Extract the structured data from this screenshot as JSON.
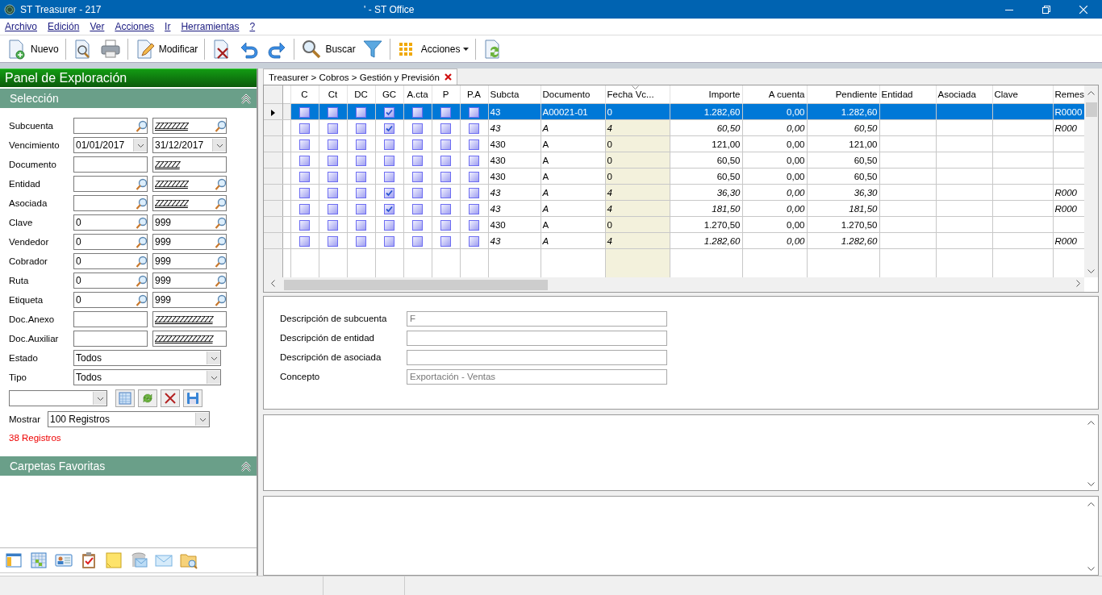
{
  "window": {
    "title": "ST Treasurer - 217",
    "subtitle": "' - ST Office"
  },
  "menu": [
    {
      "label": "Archivo"
    },
    {
      "label": "Edición"
    },
    {
      "label": "Ver"
    },
    {
      "label": "Acciones"
    },
    {
      "label": "Ir"
    },
    {
      "label": "Herramientas"
    },
    {
      "label": "?"
    }
  ],
  "toolbar": [
    {
      "kind": "button",
      "label": "Nuevo"
    },
    {
      "kind": "separator"
    },
    {
      "kind": "button"
    },
    {
      "kind": "button"
    },
    {
      "kind": "separator"
    },
    {
      "kind": "button",
      "label": "Modificar"
    },
    {
      "kind": "separator"
    },
    {
      "kind": "button"
    },
    {
      "kind": "button"
    },
    {
      "kind": "button"
    },
    {
      "kind": "separator"
    },
    {
      "kind": "button",
      "label": "Buscar"
    },
    {
      "kind": "button"
    },
    {
      "kind": "separator"
    },
    {
      "kind": "button",
      "label": "Acciones",
      "dropdown": true
    },
    {
      "kind": "separator"
    },
    {
      "kind": "button"
    }
  ],
  "explorer": {
    "title": "Panel de Exploración",
    "selection_title": "Selección",
    "filters": [
      {
        "label": "Subcuenta",
        "kind": "search",
        "to": {
          "value": "ZZZZZZZZ",
          "mask": true
        }
      },
      {
        "label": "Vencimiento",
        "kind": "date",
        "from": {
          "value": "01/01/2017"
        },
        "to": {
          "value": "31/12/2017"
        }
      },
      {
        "label": "Documento",
        "kind": "text",
        "to": {
          "value": "ZZZZZZ",
          "mask": true
        }
      },
      {
        "label": "Entidad",
        "kind": "search",
        "to": {
          "value": "ZZZZZZZZ",
          "mask": true
        }
      },
      {
        "label": "Asociada",
        "kind": "search",
        "to": {
          "value": "ZZZZZZZZ",
          "mask": true
        }
      },
      {
        "label": "Clave",
        "kind": "search",
        "from": {
          "value": "0"
        },
        "to": {
          "value": "999"
        }
      },
      {
        "label": "Vendedor",
        "kind": "search",
        "from": {
          "value": "0"
        },
        "to": {
          "value": "999"
        }
      },
      {
        "label": "Cobrador",
        "kind": "search",
        "from": {
          "value": "0"
        },
        "to": {
          "value": "999"
        }
      },
      {
        "label": "Ruta",
        "kind": "search",
        "from": {
          "value": "0"
        },
        "to": {
          "value": "999"
        }
      },
      {
        "label": "Etiqueta",
        "kind": "search",
        "from": {
          "value": "0"
        },
        "to": {
          "value": "999"
        }
      },
      {
        "label": "Doc.Anexo",
        "kind": "text",
        "to": {
          "value": "ZZZZZZZZZZZZZZ",
          "mask": true
        }
      },
      {
        "label": "Doc.Auxiliar",
        "kind": "text",
        "to": {
          "value": "ZZZZZZZZZZZZZZ",
          "mask": true
        }
      },
      {
        "label": "Estado",
        "kind": "select",
        "value": "Todos"
      },
      {
        "label": "Tipo",
        "kind": "select",
        "value": "Todos"
      }
    ],
    "show_label": "Mostrar",
    "show_value": "100  Registros",
    "count": "38 Registros",
    "favorites_title": "Carpetas Favoritas"
  },
  "tab": {
    "label": "Treasurer > Cobros > Gestión y Previsión",
    "selected": true
  },
  "table": {
    "check_columns": [
      {
        "label": "C"
      },
      {
        "label": "Ct"
      },
      {
        "label": "DC"
      },
      {
        "label": "GC"
      },
      {
        "label": "A.cta"
      },
      {
        "label": "P"
      },
      {
        "label": "P.A"
      }
    ],
    "columns": [
      {
        "label": "Subcta",
        "kind": "text"
      },
      {
        "label": "Documento",
        "kind": "text"
      },
      {
        "label": "Fecha Vc...",
        "kind": "text",
        "sorted": true
      },
      {
        "label": "Importe",
        "kind": "number"
      },
      {
        "label": "A cuenta",
        "kind": "number"
      },
      {
        "label": "Pendiente",
        "kind": "number"
      },
      {
        "label": "Entidad",
        "kind": "text"
      },
      {
        "label": "Asociada",
        "kind": "text"
      },
      {
        "label": "Clave",
        "kind": "text"
      },
      {
        "label": "Remes",
        "kind": "text"
      }
    ],
    "rows": [
      {
        "selected": true,
        "italic": false,
        "checks": [
          false,
          false,
          false,
          true,
          false,
          false,
          false
        ],
        "cells": [
          "43",
          "A00021-01",
          "0",
          "1.282,60",
          "0,00",
          "1.282,60",
          "",
          "",
          "",
          "R0000"
        ]
      },
      {
        "selected": false,
        "italic": true,
        "checks": [
          false,
          false,
          false,
          true,
          false,
          false,
          false
        ],
        "cells": [
          "43",
          "A",
          "4",
          "60,50",
          "0,00",
          "60,50",
          "",
          "",
          "",
          "R000"
        ]
      },
      {
        "selected": false,
        "italic": false,
        "checks": [
          false,
          false,
          false,
          false,
          false,
          false,
          false
        ],
        "cells": [
          "430",
          "A",
          "0",
          "121,00",
          "0,00",
          "121,00",
          "",
          "",
          "",
          ""
        ]
      },
      {
        "selected": false,
        "italic": false,
        "checks": [
          false,
          false,
          false,
          false,
          false,
          false,
          false
        ],
        "cells": [
          "430",
          "A",
          "0",
          "60,50",
          "0,00",
          "60,50",
          "",
          "",
          "",
          ""
        ]
      },
      {
        "selected": false,
        "italic": false,
        "checks": [
          false,
          false,
          false,
          false,
          false,
          false,
          false
        ],
        "cells": [
          "430",
          "A",
          "0",
          "60,50",
          "0,00",
          "60,50",
          "",
          "",
          "",
          ""
        ]
      },
      {
        "selected": false,
        "italic": true,
        "checks": [
          false,
          false,
          false,
          true,
          false,
          false,
          false
        ],
        "cells": [
          "43",
          "A",
          "4",
          "36,30",
          "0,00",
          "36,30",
          "",
          "",
          "",
          "R000"
        ]
      },
      {
        "selected": false,
        "italic": true,
        "checks": [
          false,
          false,
          false,
          true,
          false,
          false,
          false
        ],
        "cells": [
          "43",
          "A",
          "4",
          "181,50",
          "0,00",
          "181,50",
          "",
          "",
          "",
          "R000"
        ]
      },
      {
        "selected": false,
        "italic": false,
        "checks": [
          false,
          false,
          false,
          false,
          false,
          false,
          false
        ],
        "cells": [
          "430",
          "A",
          "0",
          "1.270,50",
          "0,00",
          "1.270,50",
          "",
          "",
          "",
          ""
        ]
      },
      {
        "selected": false,
        "italic": true,
        "checks": [
          false,
          false,
          false,
          false,
          false,
          false,
          false
        ],
        "cells": [
          "43",
          "A",
          "4",
          "1.282,60",
          "0,00",
          "1.282,60",
          "",
          "",
          "",
          "R000"
        ]
      }
    ]
  },
  "details": [
    {
      "label": "Descripción de subcuenta",
      "value": "F"
    },
    {
      "label": "Descripción de entidad"
    },
    {
      "label": "Descripción de asociada"
    },
    {
      "label": "Concepto",
      "value": "Exportación - Ventas"
    }
  ]
}
